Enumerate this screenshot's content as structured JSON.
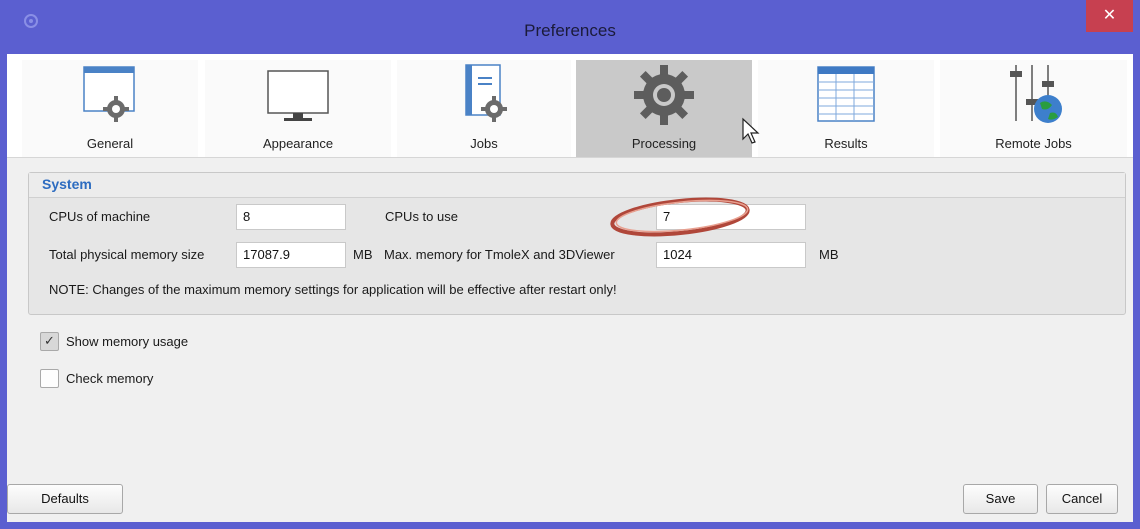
{
  "window": {
    "title": "Preferences",
    "close_glyph": "✕"
  },
  "tabs": [
    {
      "label": "General",
      "icon": "window-gear-icon",
      "active": false
    },
    {
      "label": "Appearance",
      "icon": "monitor-icon",
      "active": false
    },
    {
      "label": "Jobs",
      "icon": "notebook-gear-icon",
      "active": false
    },
    {
      "label": "Processing",
      "icon": "gear-icon",
      "active": true
    },
    {
      "label": "Results",
      "icon": "table-icon",
      "active": false
    },
    {
      "label": "Remote Jobs",
      "icon": "globe-sliders-icon",
      "active": false
    }
  ],
  "system": {
    "title": "System",
    "cpus_machine_label": "CPUs of machine",
    "cpus_machine_value": "8",
    "cpus_use_label": "CPUs to use",
    "cpus_use_value": "7",
    "total_mem_label": "Total physical memory size",
    "total_mem_value": "17087.9",
    "total_mem_unit": "MB",
    "max_mem_label": "Max. memory for TmoleX and 3DViewer",
    "max_mem_value": "1024",
    "max_mem_unit": "MB",
    "note": "NOTE: Changes of the maximum memory settings for application will be effective after restart only!"
  },
  "options": {
    "show_memory_label": "Show memory usage",
    "show_memory_checked": true,
    "check_memory_label": "Check memory",
    "check_memory_checked": false,
    "check_glyph": "✓"
  },
  "buttons": {
    "defaults": "Defaults",
    "save": "Save",
    "cancel": "Cancel"
  },
  "colors": {
    "titlebar": "#5b5fd0",
    "close": "#c74050",
    "group_title": "#2d6cc0",
    "highlight": "#c0392b"
  }
}
